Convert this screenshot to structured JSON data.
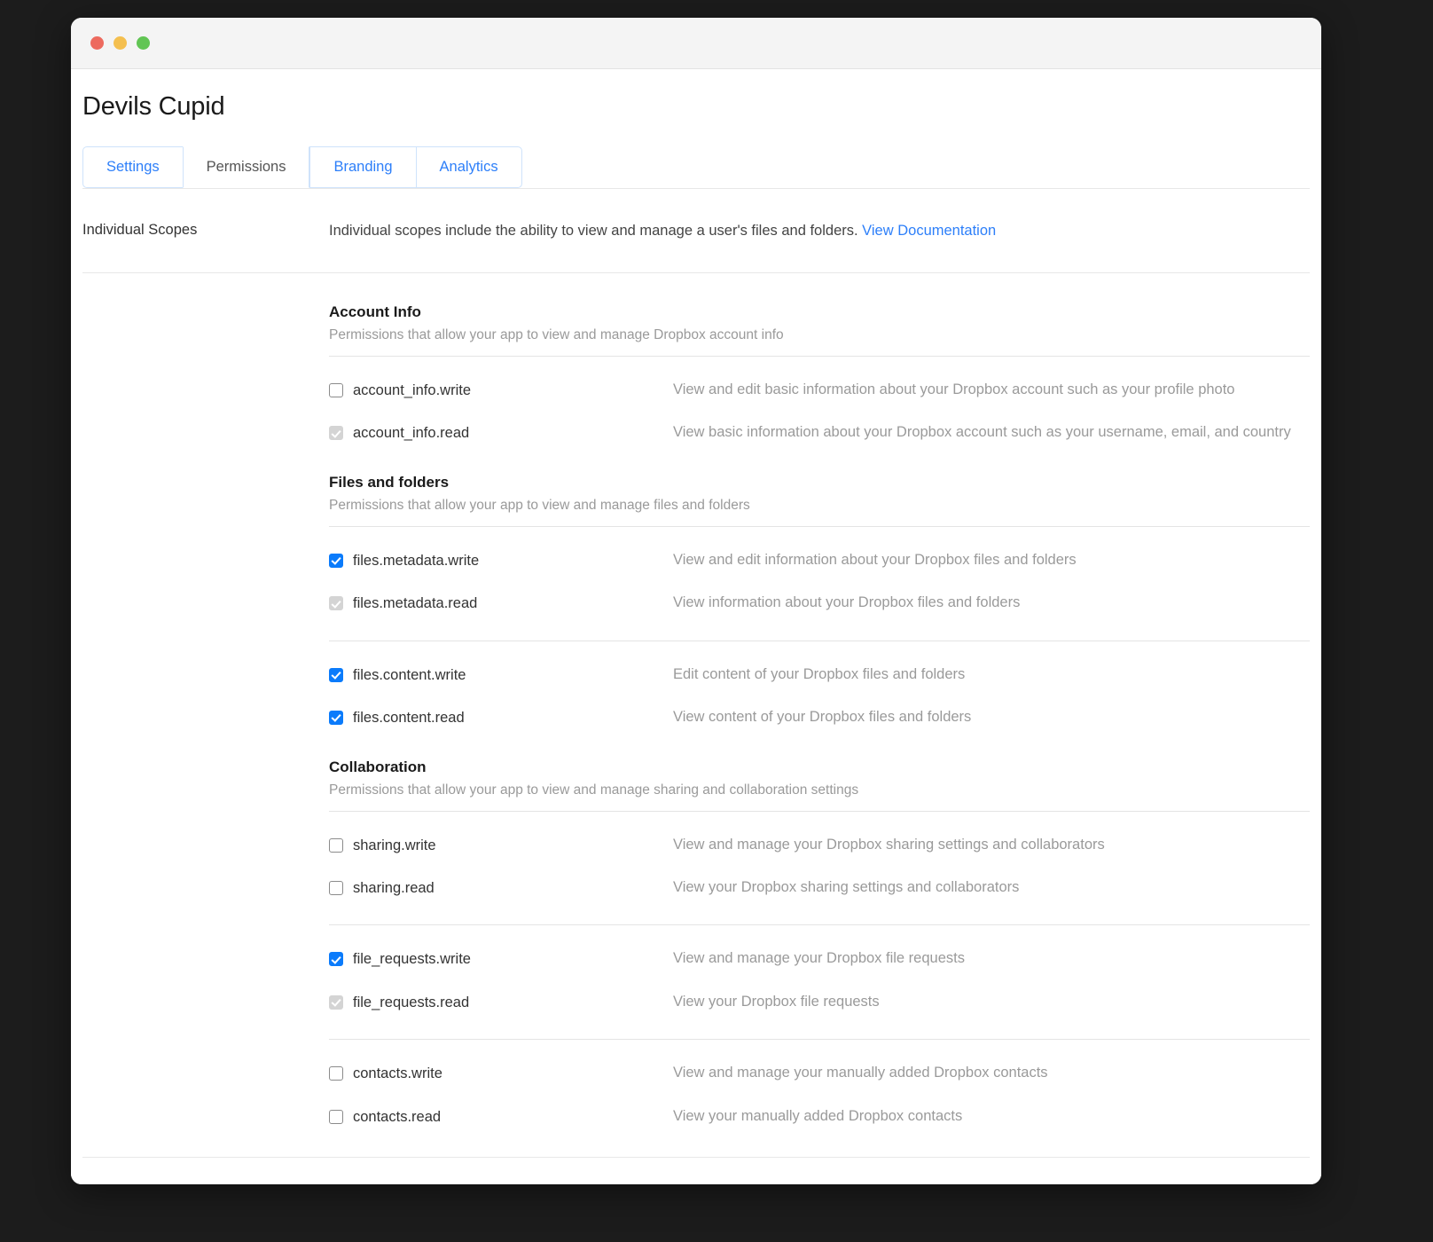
{
  "window": {
    "traffic_lights": [
      "close-button",
      "minimize-button",
      "zoom-button"
    ],
    "app_title": "Devils Cupid"
  },
  "tabs": [
    {
      "label": "Settings",
      "active": false
    },
    {
      "label": "Permissions",
      "active": true
    },
    {
      "label": "Branding",
      "active": false
    },
    {
      "label": "Analytics",
      "active": false
    }
  ],
  "scopes_section": {
    "label": "Individual Scopes",
    "description": "Individual scopes include the ability to view and manage a user's files and folders.",
    "link_label": "View Documentation"
  },
  "groups": [
    {
      "title": "Account Info",
      "subtitle": "Permissions that allow your app to view and manage Dropbox account info",
      "pairs": [
        {
          "divider_after": false,
          "rows": [
            {
              "name": "account_info.write",
              "state": "unchecked",
              "description": "View and edit basic information about your Dropbox account such as your profile photo"
            },
            {
              "name": "account_info.read",
              "state": "disabled-checked",
              "description": "View basic information about your Dropbox account such as your username, email, and country"
            }
          ]
        }
      ]
    },
    {
      "title": "Files and folders",
      "subtitle": "Permissions that allow your app to view and manage files and folders",
      "pairs": [
        {
          "divider_after": true,
          "rows": [
            {
              "name": "files.metadata.write",
              "state": "checked",
              "description": "View and edit information about your Dropbox files and folders"
            },
            {
              "name": "files.metadata.read",
              "state": "disabled-checked",
              "description": "View information about your Dropbox files and folders"
            }
          ]
        },
        {
          "divider_after": false,
          "rows": [
            {
              "name": "files.content.write",
              "state": "checked",
              "description": "Edit content of your Dropbox files and folders"
            },
            {
              "name": "files.content.read",
              "state": "checked",
              "description": "View content of your Dropbox files and folders"
            }
          ]
        }
      ]
    },
    {
      "title": "Collaboration",
      "subtitle": "Permissions that allow your app to view and manage sharing and collaboration settings",
      "pairs": [
        {
          "divider_after": true,
          "rows": [
            {
              "name": "sharing.write",
              "state": "unchecked",
              "description": "View and manage your Dropbox sharing settings and collaborators"
            },
            {
              "name": "sharing.read",
              "state": "unchecked",
              "description": "View your Dropbox sharing settings and collaborators"
            }
          ]
        },
        {
          "divider_after": true,
          "rows": [
            {
              "name": "file_requests.write",
              "state": "checked",
              "description": "View and manage your Dropbox file requests"
            },
            {
              "name": "file_requests.read",
              "state": "disabled-checked",
              "description": "View your Dropbox file requests"
            }
          ]
        },
        {
          "divider_after": false,
          "rows": [
            {
              "name": "contacts.write",
              "state": "unchecked",
              "description": "View and manage your manually added Dropbox contacts"
            },
            {
              "name": "contacts.read",
              "state": "unchecked",
              "description": "View your manually added Dropbox contacts"
            }
          ]
        }
      ]
    }
  ],
  "colors": {
    "accent_blue": "#0b7bfb",
    "link_blue": "#2d7ff9",
    "tab_border": "#cfe3fb",
    "muted_text": "#9a9a9a",
    "divider": "#e4e4e4",
    "desktop_bg": "#1c1c1c",
    "titlebar_bg": "#f4f4f4",
    "traffic_red": "#ed6a5e",
    "traffic_yellow": "#f4bf4f",
    "traffic_green": "#61c554"
  }
}
